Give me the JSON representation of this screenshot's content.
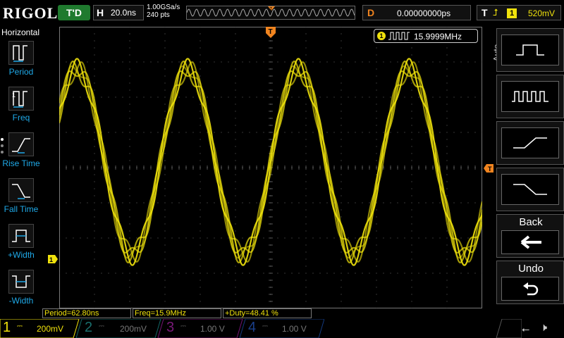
{
  "header": {
    "logo": "RIGOL",
    "trigger_status": "T'D",
    "horizontal": {
      "label": "H",
      "timebase": "20.0ns"
    },
    "sample_rate": "1.00GSa/s",
    "memory_depth": "240 pts",
    "delay": {
      "label": "D",
      "value": "0.00000000ps"
    },
    "trigger": {
      "label": "T",
      "edge_icon": "rising-edge-icon",
      "channel": "1",
      "level": "520mV"
    }
  },
  "left_menu": {
    "title": "Horizontal",
    "items": [
      {
        "label": "Period",
        "icon": "period-icon"
      },
      {
        "label": "Freq",
        "icon": "frequency-icon"
      },
      {
        "label": "Rise Time",
        "icon": "rise-time-icon"
      },
      {
        "label": "Fall Time",
        "icon": "fall-time-icon"
      },
      {
        "label": "+Width",
        "icon": "positive-width-icon"
      },
      {
        "label": "-Width",
        "icon": "negative-width-icon"
      }
    ]
  },
  "display": {
    "trigger_marker": "T",
    "channel_marker": "1",
    "frequency_counter": {
      "channel": "1",
      "value": "15.9999MHz"
    }
  },
  "right_panel": {
    "mode_label": "Auto",
    "buttons": [
      {
        "icon": "single-pulse-icon"
      },
      {
        "icon": "pulse-train-icon"
      },
      {
        "icon": "rising-edge-icon"
      },
      {
        "icon": "falling-edge-icon"
      },
      {
        "label": "Back",
        "icon": "back-arrow-icon",
        "glyph": "🡐"
      },
      {
        "label": "Undo",
        "icon": "undo-icon",
        "glyph": "↶"
      }
    ]
  },
  "measurements": [
    {
      "text": "Period=62.80ns"
    },
    {
      "text": "Freq=15.9MHz"
    },
    {
      "text": "+Duty=48.41 %"
    }
  ],
  "channels": [
    {
      "number": "1",
      "scale": "200mV",
      "color": "#f0e20c",
      "active": true
    },
    {
      "number": "2",
      "scale": "200mV",
      "color": "#1fa9a8",
      "active": false
    },
    {
      "number": "3",
      "scale": "1.00 V",
      "color": "#c020c0",
      "active": false
    },
    {
      "number": "4",
      "scale": "1.00 V",
      "color": "#2060d0",
      "active": false
    }
  ],
  "colors": {
    "ch1": "#f0e20c",
    "delay": "#f0841f",
    "menu_label": "#1fa9e8"
  }
}
